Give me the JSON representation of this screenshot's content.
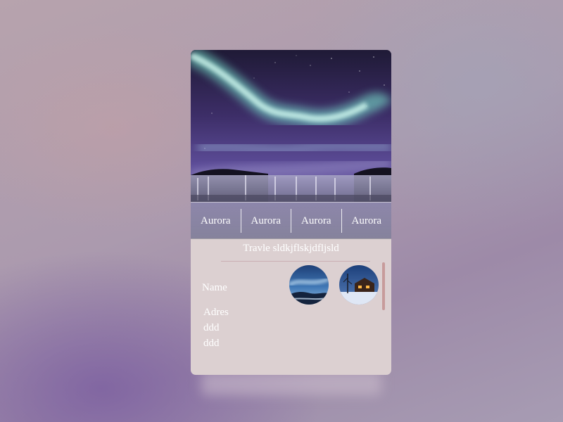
{
  "hero": {
    "image": "aurora-waterfall-photo"
  },
  "tabs": [
    {
      "label": "Aurora"
    },
    {
      "label": "Aurora"
    },
    {
      "label": "Aurora"
    },
    {
      "label": "Aurora"
    }
  ],
  "subtitle": "Travle sldkjflskjdfljsld",
  "name_label": "Name",
  "thumbnails": [
    {
      "image": "aurora-lake-photo"
    },
    {
      "image": "snowy-cabin-photo"
    }
  ],
  "address_lines": [
    "Adres",
    "ddd",
    "ddd"
  ],
  "colors": {
    "card_bg": "#dcd0d1",
    "scrollbar": "#c79b9b",
    "text": "#ffffff"
  }
}
